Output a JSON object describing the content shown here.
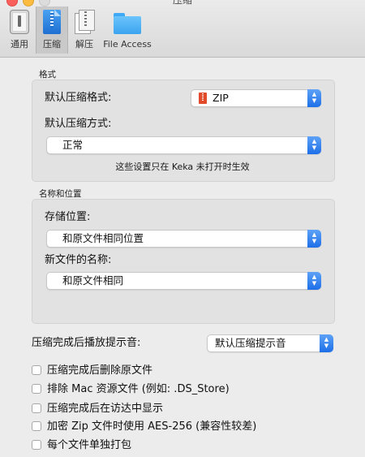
{
  "window": {
    "title": "压缩"
  },
  "toolbar": {
    "tabs": [
      {
        "label": "通用",
        "icon": "general-switch-icon"
      },
      {
        "label": "压缩",
        "icon": "compress-zip-icon"
      },
      {
        "label": "解压",
        "icon": "extract-icon"
      },
      {
        "label": "File Access",
        "icon": "folder-icon"
      }
    ],
    "selected": "压缩"
  },
  "format_group": {
    "title": "格式",
    "default_format_label": "默认压缩格式:",
    "default_format_value": "ZIP",
    "default_method_label": "默认压缩方式:",
    "default_method_value": "正常",
    "note": "这些设置只在 Keka 未打开时生效"
  },
  "location_group": {
    "title": "名称和位置",
    "save_location_label": "存储位置:",
    "save_location_value": "和原文件相同位置",
    "file_name_label": "新文件的名称:",
    "file_name_value": "和原文件相同"
  },
  "sound": {
    "label": "压缩完成后播放提示音:",
    "value": "默认压缩提示音"
  },
  "options": [
    {
      "label": "压缩完成后删除原文件",
      "checked": false
    },
    {
      "label": "排除 Mac 资源文件 (例如: .DS_Store)",
      "checked": false
    },
    {
      "label": "压缩完成后在访达中显示",
      "checked": false
    },
    {
      "label": "加密 Zip 文件时使用 AES-256 (兼容性较差)",
      "checked": false
    },
    {
      "label": "每个文件单独打包",
      "checked": false
    }
  ],
  "colors": {
    "accent": "#2a7ff0",
    "zip_icon": "#e24a2c"
  }
}
